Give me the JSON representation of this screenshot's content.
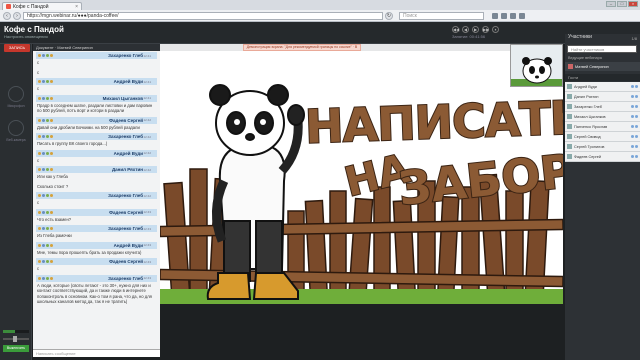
{
  "browser": {
    "tab_title": "Кофе с Пандой",
    "tab_close": "×",
    "url": "https://mgn.webinar.ru/●●●/panda-coffee/",
    "search_placeholder": "Поиск",
    "window_buttons": [
      "–",
      "□",
      "×"
    ]
  },
  "app": {
    "title": "Кофе с Пандой",
    "subtitle": "Настроить оповещения",
    "record_label": "ЗАПИСЬ",
    "document_label": "Документ · Матвей Северинин",
    "notice": "Демонстрация экрана: \"Для рекомендуемой границы по ссылке\" · В присоединившихся",
    "player_buttons": [
      "◀◀",
      "◀",
      "▶",
      "▶▶",
      "⏸"
    ],
    "timer": "Занятие: 00:41:56",
    "rail_labels": [
      "Микрофон",
      "Веб-камера"
    ],
    "bottom_button": "Выключить",
    "chat_input_placeholder": "Написать сообщение"
  },
  "chat": {
    "messages": [
      {
        "author": "Захаренко Глеб",
        "time": "12:41",
        "text": "с"
      },
      {
        "author": "",
        "time": "",
        "text": "с"
      },
      {
        "author": "Андрей Вуди",
        "time": "12:41",
        "text": "с"
      },
      {
        "author": "Михаил Цыганков",
        "time": "12:41",
        "text": "Прадр в соседнем шатке, раздали листовки и дам паровин по 500 рублей, потъ ворт и котори в раздали"
      },
      {
        "author": "Фадеев Сергей",
        "time": "12:42",
        "text": "Давай они дробили Бочкими. на 500 рублей раздали"
      },
      {
        "author": "Захаренко Глеб",
        "time": "12:42",
        "text": "Писать в группу ВК своего города...)"
      },
      {
        "author": "Андрей Вуди",
        "time": "12:42",
        "text": "с"
      },
      {
        "author": "Данил Ряхтин",
        "time": "12:42",
        "text": "Или как у Глеба"
      },
      {
        "author": "",
        "time": "",
        "text": "Сколько стоит ?"
      },
      {
        "author": "Захаренко Глеб",
        "time": "12:42",
        "text": "с"
      },
      {
        "author": "Фадеев Сергей",
        "time": "12:43",
        "text": "Что есть взамен?"
      },
      {
        "author": "Захаренко Глеб",
        "time": "12:43",
        "text": "Из Глеба рамочки"
      },
      {
        "author": "Андрей Вуди",
        "time": "12:43",
        "text": "Мне, темы пора прошепть брать за продажи клучита)"
      },
      {
        "author": "Фадеев Сергей",
        "time": "12:43",
        "text": "с"
      },
      {
        "author": "Захаренко Глеб",
        "time": "12:43",
        "text": "А люди, которые (своты летают - это 30+, нужно для них и контакт соответствующий, да и также люди в интернете попаконтроль в основном. Как-о том я рана, что да, но для школьных каналов метод да, так я не тратить)"
      }
    ]
  },
  "slide": {
    "line1": "НАПИСАТЬ",
    "line2": "НА",
    "line3": "ЗАБОРЕ"
  },
  "participants": {
    "header": "Участники",
    "count": "1/8",
    "search_placeholder": "Найти участников",
    "leader_header": "Ведущие вебинара",
    "leader": "Матвей Северинин",
    "guests_header": "Гости",
    "guests": [
      "Андрей Вуди",
      "Данил Ряхтин",
      "Захаренко Глеб",
      "Михаил Цыганков",
      "Панченко Ярослав",
      "Сергей Свивод",
      "Сергей Тропилов",
      "Фадеев Сергей"
    ]
  },
  "colors": {
    "record": "#c5372c",
    "accent_green": "#3a9b3a",
    "slide_text": "#8b5a34"
  }
}
